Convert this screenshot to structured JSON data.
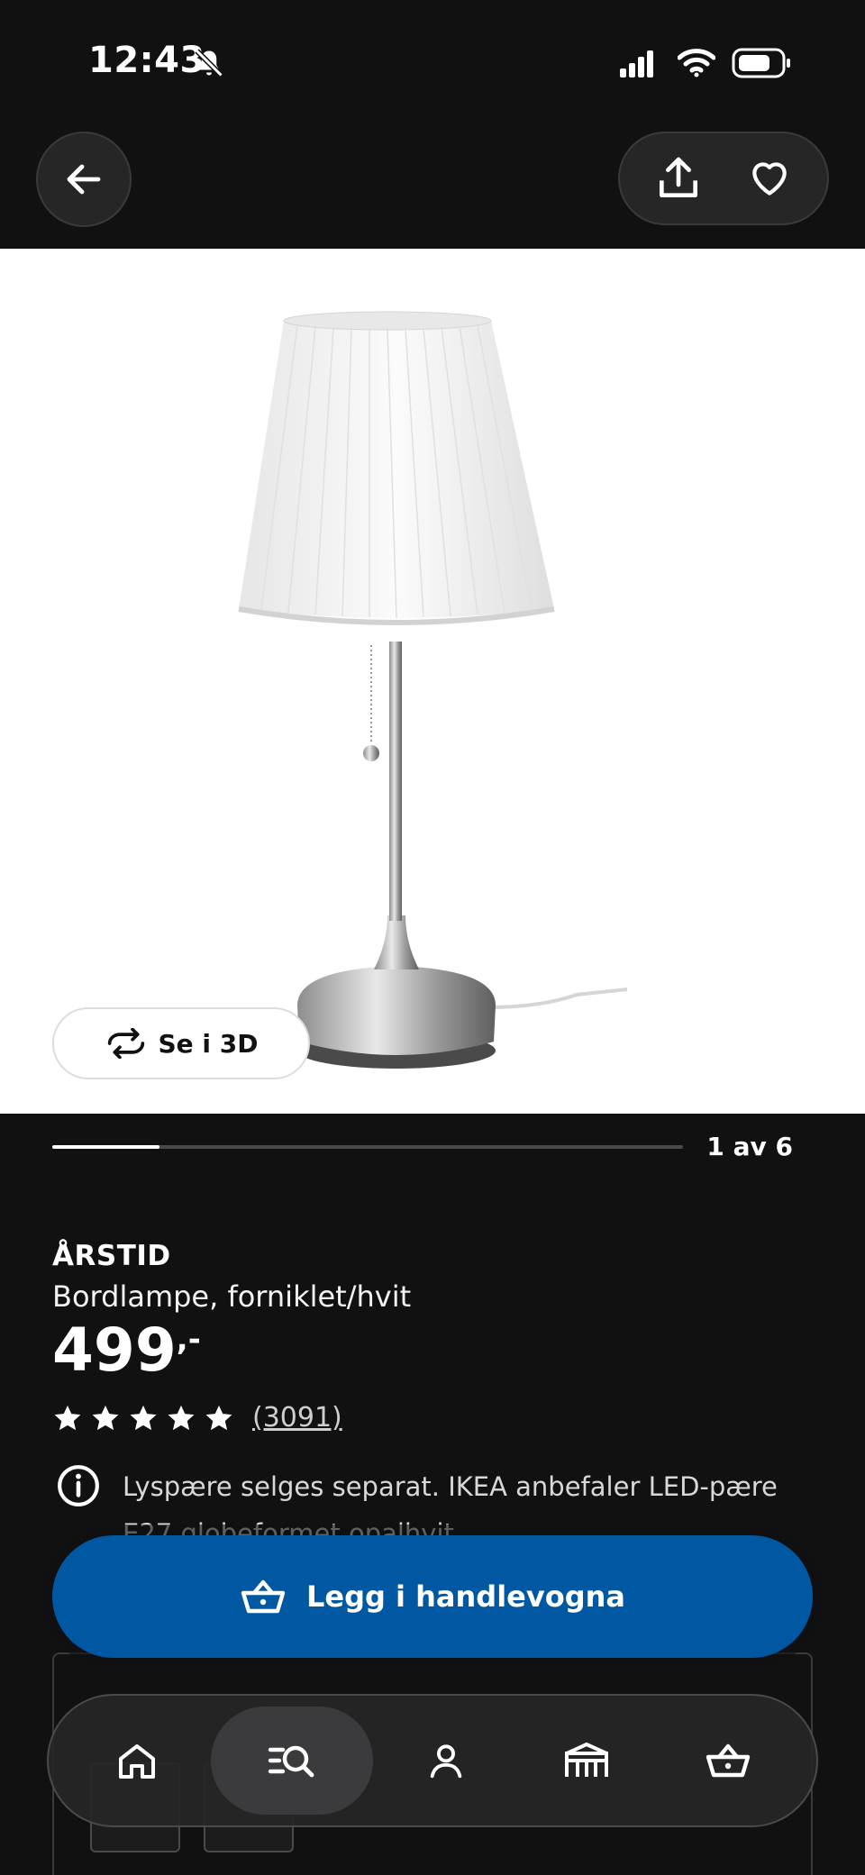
{
  "status_bar": {
    "time": "12:43"
  },
  "product": {
    "name": "ÅRSTID",
    "description": "Bordlampe, forniklet/hvit",
    "price": "499",
    "price_suffix": ",-",
    "rating_stars": 5,
    "review_count": "(3091)",
    "info_text": "Lyspære selges separat. IKEA anbefaler LED-pære E27 globeformet opalhvit."
  },
  "gallery": {
    "view_3d_label": "Se i 3D",
    "counter": "1 av 6",
    "progress": 0.17
  },
  "cart_button_label": "Legg i handlevogna",
  "bottom_nav": {
    "items": [
      {
        "name": "home",
        "icon": "home-icon"
      },
      {
        "name": "search",
        "icon": "search-list-icon",
        "active": true
      },
      {
        "name": "profile",
        "icon": "person-icon"
      },
      {
        "name": "stores",
        "icon": "store-icon"
      },
      {
        "name": "cart",
        "icon": "basket-icon"
      }
    ]
  },
  "colors": {
    "background": "#111112",
    "primary": "#0058a3",
    "text": "#ffffff"
  }
}
